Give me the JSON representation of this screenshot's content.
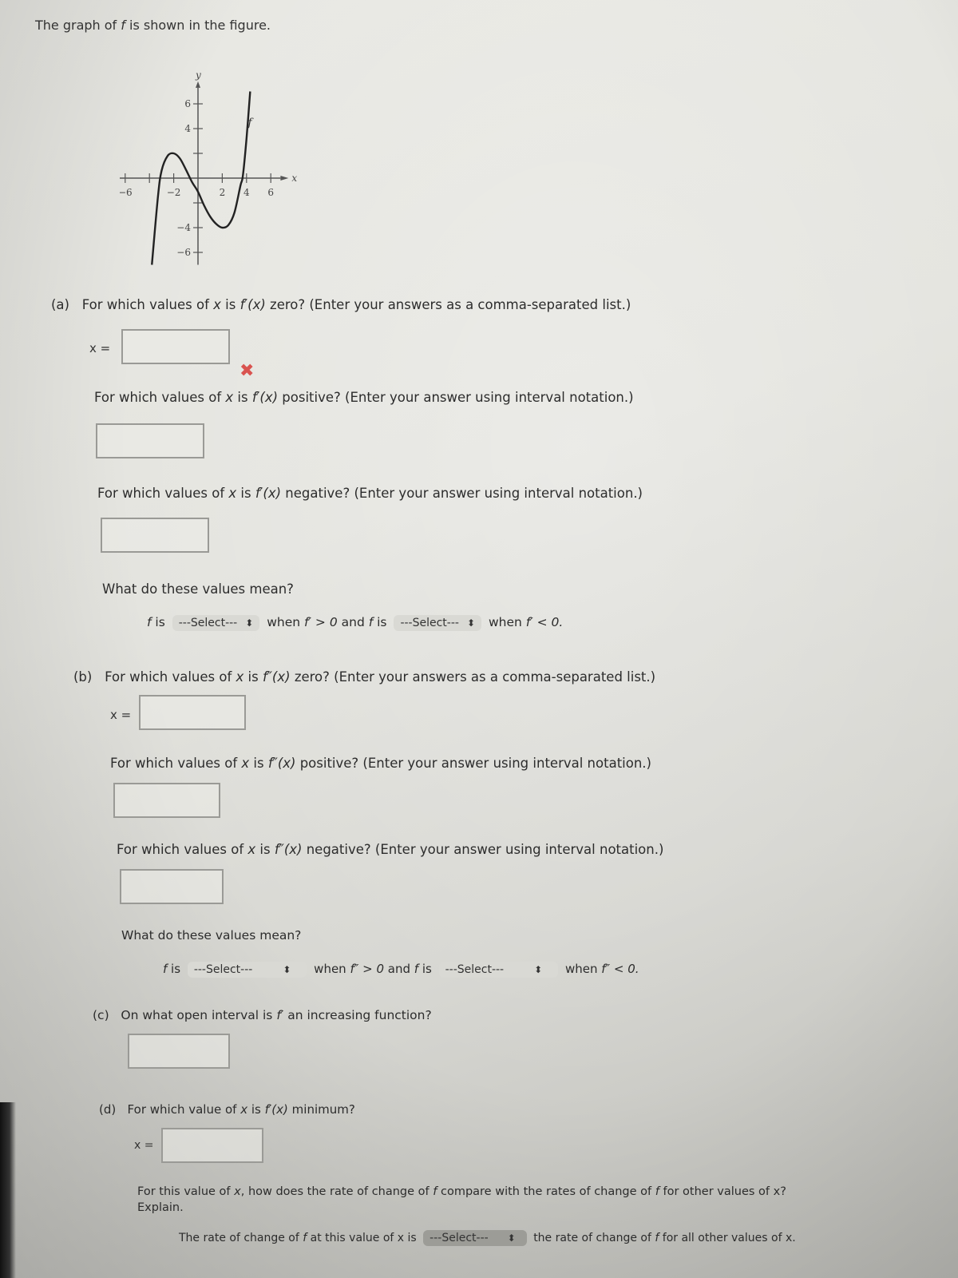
{
  "intro": {
    "pre": "The graph of ",
    "f": "f",
    "post": " is shown in the figure."
  },
  "chart_data": {
    "type": "line",
    "title": "",
    "xlabel": "x",
    "ylabel": "y",
    "curve_label": "f",
    "xlim": [
      -6.5,
      7
    ],
    "ylim": [
      -7,
      7.5
    ],
    "x_ticks": [
      -6,
      -4,
      -2,
      2,
      4,
      6
    ],
    "x_tick_labels": [
      "-6",
      "",
      "-2",
      "2",
      "4",
      "6"
    ],
    "y_ticks": [
      -6,
      -4,
      -2,
      2,
      4,
      6
    ],
    "y_tick_labels": [
      "-6",
      "-4",
      "",
      "",
      "4",
      "6"
    ],
    "series": [
      {
        "name": "f",
        "x": [
          -3.8,
          -3.3,
          -3,
          -2.5,
          -2,
          -1.5,
          -1,
          -0.5,
          0,
          0.5,
          1,
          1.5,
          2,
          2.5,
          3,
          3.5,
          3.7,
          4,
          4.3
        ],
        "y": [
          -7,
          -1.5,
          0.6,
          1.8,
          2,
          1.6,
          0.7,
          -0.3,
          -1.1,
          -2.2,
          -3.1,
          -3.7,
          -4,
          -3.8,
          -2.8,
          -0.6,
          0.2,
          3.2,
          7
        ]
      }
    ],
    "grid": false
  },
  "a": {
    "label": "(a)",
    "q1": {
      "pre": "For which values of ",
      "x": "x",
      "mid": " is ",
      "fn": "f′(x)",
      "post": " zero? (Enter your answers as a comma-separated list.)"
    },
    "xeq": "x =",
    "input1_value": "",
    "wrong_mark": "✖",
    "q2": {
      "pre": "For which values of ",
      "x": "x",
      "mid": " is ",
      "fn": "f′(x)",
      "post": " positive? (Enter your answer using interval notation.)"
    },
    "input2_value": "",
    "q3": {
      "pre": "For which values of ",
      "x": "x",
      "mid": " is ",
      "fn": "f′(x)",
      "post": " negative? (Enter your answer using interval notation.)"
    },
    "input3_value": "",
    "meaning": "What do these values mean?",
    "sentence": {
      "f1": "f",
      "is1": " is",
      "sel1": "---Select---",
      "when1": " when ",
      "cond1": "f′ > 0",
      "and": " and ",
      "f2": "f",
      "is2": " is",
      "sel2": "---Select---",
      "when2": " when ",
      "cond2": "f′ < 0."
    }
  },
  "b": {
    "label": "(b)",
    "q1": {
      "pre": "For which values of ",
      "x": "x",
      "mid": " is ",
      "fn": "f″(x)",
      "post": " zero? (Enter your answers as a comma-separated list.)"
    },
    "xeq": "x =",
    "input1_value": "",
    "q2": {
      "pre": "For which values of ",
      "x": "x",
      "mid": " is ",
      "fn": "f″(x)",
      "post": " positive? (Enter your answer using interval notation.)"
    },
    "input2_value": "",
    "q3": {
      "pre": "For which values of ",
      "x": "x",
      "mid": " is ",
      "fn": "f″(x)",
      "post": " negative? (Enter your answer using interval notation.)"
    },
    "input3_value": "",
    "meaning": "What do these values mean?",
    "sentence": {
      "f1": "f",
      "is1": " is",
      "sel1": "---Select---",
      "when1": " when ",
      "cond1": "f″ > 0",
      "and": " and ",
      "f2": "f",
      "is2": " is",
      "sel2": "---Select---",
      "when2": " when ",
      "cond2": "f″ < 0."
    }
  },
  "c": {
    "label": "(c)",
    "q": {
      "pre": "On what open interval is ",
      "fn": "f′",
      "post": " an increasing function?"
    },
    "input_value": ""
  },
  "d": {
    "label": "(d)",
    "q": {
      "pre": "For which value of ",
      "x": "x",
      "mid": " is ",
      "fn": "f′(x)",
      "post": " minimum?"
    },
    "xeq": "x =",
    "input_value": "",
    "explain": {
      "pre": "For this value of ",
      "x": "x",
      "mid1": ", how does the rate of change of ",
      "f1": "f",
      "mid2": " compare with the rates of change of ",
      "f2": "f",
      "post": " for other values of x?",
      "line2": "Explain."
    },
    "sentence": {
      "pre": "The rate of change of ",
      "f1": "f",
      "mid": " at this value of x is",
      "sel": "---Select---",
      "post1": " the rate of change of ",
      "f2": "f",
      "post2": " for all other values of x."
    }
  },
  "icons": {
    "select_chevron": "⬍"
  }
}
